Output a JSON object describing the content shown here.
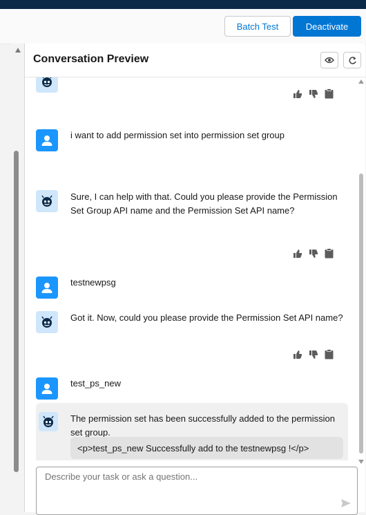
{
  "toolbar": {
    "batch_test_label": "Batch Test",
    "deactivate_label": "Deactivate"
  },
  "panel": {
    "title": "Conversation Preview"
  },
  "messages": [
    {
      "role": "user",
      "text": "i want to add permission set into permission set group"
    },
    {
      "role": "agent",
      "text": "Sure, I can help with that. Could you please provide the Permission Set Group API name and the Permission Set API name?"
    },
    {
      "role": "user",
      "text": "testnewpsg"
    },
    {
      "role": "agent",
      "text": "Got it. Now, could you please provide the Permission Set API name?"
    },
    {
      "role": "user",
      "text": "test_ps_new"
    },
    {
      "role": "agent",
      "text": "The permission set has been successfully added to the permission set group.",
      "code": "<p>test_ps_new Successfully add to the testnewpsg !</p>"
    }
  ],
  "composer": {
    "placeholder": "Describe your task or ask a question..."
  },
  "colors": {
    "brand": "#0176d3",
    "user_avatar": "#1b96ff",
    "bot_avatar_bg": "#cfe6fb",
    "top_bar": "#0b2a4a"
  },
  "icons": [
    "eye-icon",
    "refresh-icon",
    "user-icon",
    "bot-icon",
    "thumbs-up-icon",
    "thumbs-down-icon",
    "clipboard-icon",
    "send-icon"
  ]
}
